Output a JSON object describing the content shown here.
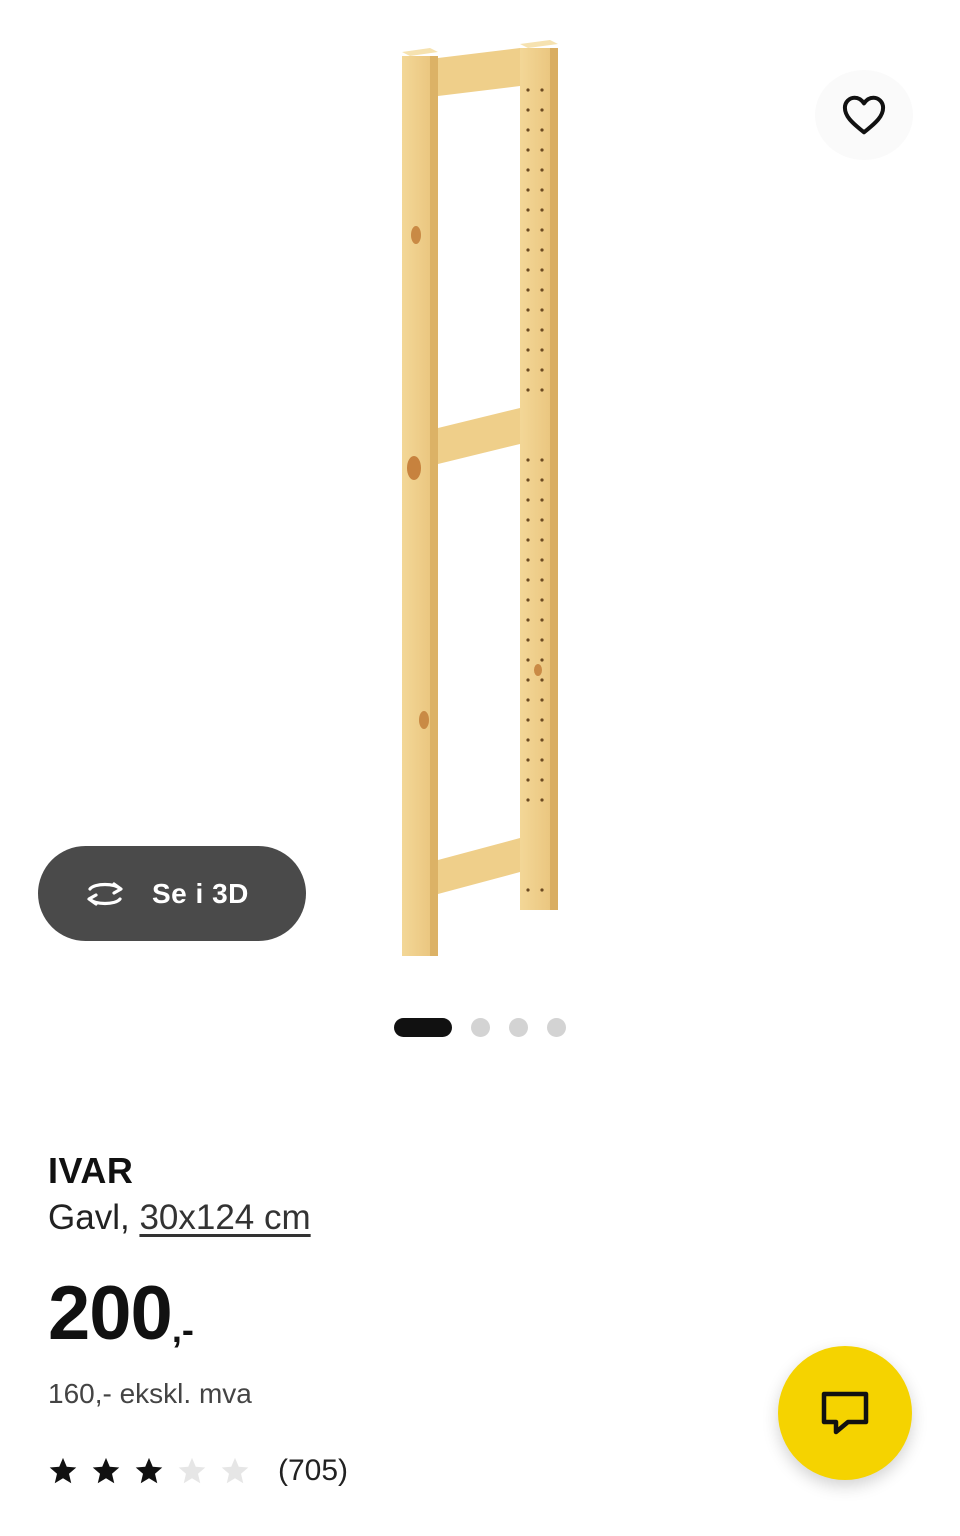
{
  "gallery": {
    "view3d_label": "Se i 3D",
    "slide_count": 4,
    "active_slide": 1
  },
  "product": {
    "name": "IVAR",
    "type_prefix": "Gavl,",
    "size": "30x124 cm",
    "price": "200",
    "price_suffix": ",-",
    "price_excl_vat": "160,- ekskl. mva",
    "rating": 3,
    "rating_max": 5,
    "review_count": "(705)"
  },
  "icons": {
    "favorite": "heart-icon",
    "view3d": "rotate-3d-icon",
    "chat": "chat-icon",
    "star": "star-icon"
  },
  "colors": {
    "chat_button": "#f5d300",
    "view3d_button": "#4a4a4a",
    "wood": "#f0d08a"
  }
}
